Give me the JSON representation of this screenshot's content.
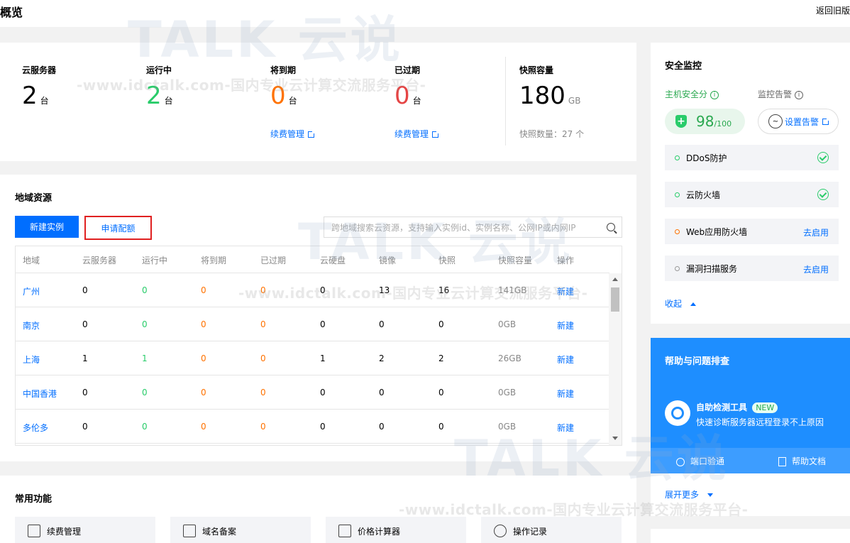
{
  "header": {
    "title": "概览",
    "back_label": "返回旧版"
  },
  "overview": {
    "stats": [
      {
        "label": "云服务器",
        "value": "2",
        "unit": "台",
        "color": "#000000"
      },
      {
        "label": "运行中",
        "value": "2",
        "unit": "台",
        "color": "#29cc6a"
      },
      {
        "label": "将到期",
        "value": "0",
        "unit": "台",
        "color": "#ff7200",
        "link": "续费管理"
      },
      {
        "label": "已过期",
        "value": "0",
        "unit": "台",
        "color": "#e54545",
        "link": "续费管理"
      }
    ],
    "snapshot": {
      "label": "快照容量",
      "value": "180",
      "unit": "GB",
      "count_label": "快照数量：27 个"
    }
  },
  "region": {
    "title": "地域资源",
    "new_instance_label": "新建实例",
    "apply_quota_label": "申请配额",
    "search_placeholder": "跨地域搜索云资源，支持输入实例id、实例名称、公网IP或内网IP",
    "columns": [
      "地域",
      "云服务器",
      "运行中",
      "将到期",
      "已过期",
      "云硬盘",
      "镜像",
      "快照",
      "快照容量",
      "操作"
    ],
    "rows": [
      {
        "region": "广州",
        "cvm": "0",
        "running": "0",
        "expiring": "0",
        "expired": "0",
        "disk": "0",
        "image": "13",
        "snapshot": "16",
        "capacity": "141GB",
        "action": "新建"
      },
      {
        "region": "南京",
        "cvm": "0",
        "running": "0",
        "expiring": "0",
        "expired": "0",
        "disk": "0",
        "image": "0",
        "snapshot": "0",
        "capacity": "0GB",
        "action": "新建"
      },
      {
        "region": "上海",
        "cvm": "1",
        "running": "1",
        "expiring": "0",
        "expired": "0",
        "disk": "1",
        "image": "2",
        "snapshot": "2",
        "capacity": "26GB",
        "action": "新建"
      },
      {
        "region": "中国香港",
        "cvm": "0",
        "running": "0",
        "expiring": "0",
        "expired": "0",
        "disk": "0",
        "image": "0",
        "snapshot": "0",
        "capacity": "0GB",
        "action": "新建"
      },
      {
        "region": "多伦多",
        "cvm": "0",
        "running": "0",
        "expiring": "0",
        "expired": "0",
        "disk": "0",
        "image": "0",
        "snapshot": "0",
        "capacity": "0GB",
        "action": "新建"
      }
    ]
  },
  "common": {
    "title": "常用功能",
    "items": [
      {
        "label": "续费管理",
        "icon": "renew-icon"
      },
      {
        "label": "域名备案",
        "icon": "domain-filing-icon"
      },
      {
        "label": "价格计算器",
        "icon": "calculator-icon"
      },
      {
        "label": "操作记录",
        "icon": "history-icon"
      }
    ]
  },
  "security": {
    "title": "安全监控",
    "score_label": "主机安全分",
    "alarm_label": "监控告警",
    "score": "98",
    "score_max": "/100",
    "alarm_button": "设置告警",
    "items": [
      {
        "label": "DDoS防护",
        "status": "enabled"
      },
      {
        "label": "云防火墙",
        "status": "enabled"
      },
      {
        "label": "Web应用防火墙",
        "action": "去启用"
      },
      {
        "label": "漏洞扫描服务",
        "action": "去启用"
      }
    ],
    "collapse_label": "收起"
  },
  "help": {
    "title": "帮助与问题排查",
    "tool_title": "自助检测工具",
    "tool_badge": "NEW",
    "tool_desc": "快速诊断服务器远程登录不上原因",
    "port_check": "端口验通",
    "docs": "帮助文档",
    "more": "展开更多"
  },
  "watermark": {
    "logo_text": "TALK 云说",
    "text": "-www.idctalk.com-国内专业云计算交流服务平台-"
  }
}
